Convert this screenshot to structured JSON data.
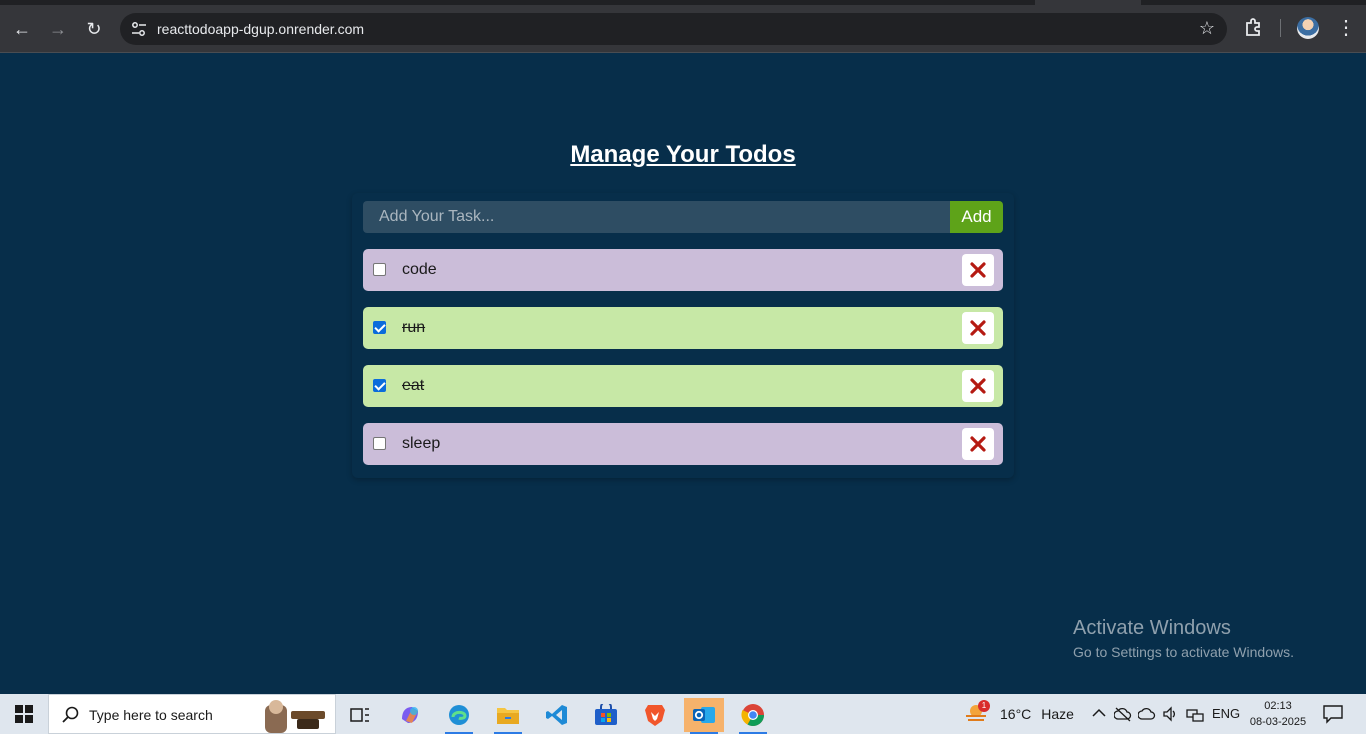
{
  "browser": {
    "url": "reacttodoapp-dgup.onrender.com",
    "back_glyph": "←",
    "forward_glyph": "→",
    "reload_glyph": "↻",
    "star_glyph": "☆",
    "menu_glyph": "⋮"
  },
  "app": {
    "title": "Manage Your Todos",
    "input_placeholder": "Add Your Task...",
    "input_value": "",
    "add_label": "Add",
    "todos": [
      {
        "text": "code",
        "completed": false
      },
      {
        "text": "run",
        "completed": true
      },
      {
        "text": "eat",
        "completed": true
      },
      {
        "text": "sleep",
        "completed": false
      }
    ],
    "colors": {
      "page_bg": "#072e4a",
      "pending_bg": "#cbbdd9",
      "done_bg": "#c7e8a6",
      "add_button": "#5ea319",
      "delete_icon": "#b51a12"
    }
  },
  "watermark": {
    "line1": "Activate Windows",
    "line2": "Go to Settings to activate Windows."
  },
  "taskbar": {
    "search_placeholder": "Type here to search",
    "weather_badge": "1",
    "weather_temp": "16°C",
    "weather_desc": "Haze",
    "language": "ENG",
    "time": "02:13",
    "date": "08-03-2025",
    "pinned": [
      "task-view-icon",
      "copilot-icon",
      "edge-icon",
      "file-explorer-icon",
      "vscode-icon",
      "store-icon",
      "brave-icon",
      "outlook-icon",
      "chrome-icon"
    ]
  }
}
